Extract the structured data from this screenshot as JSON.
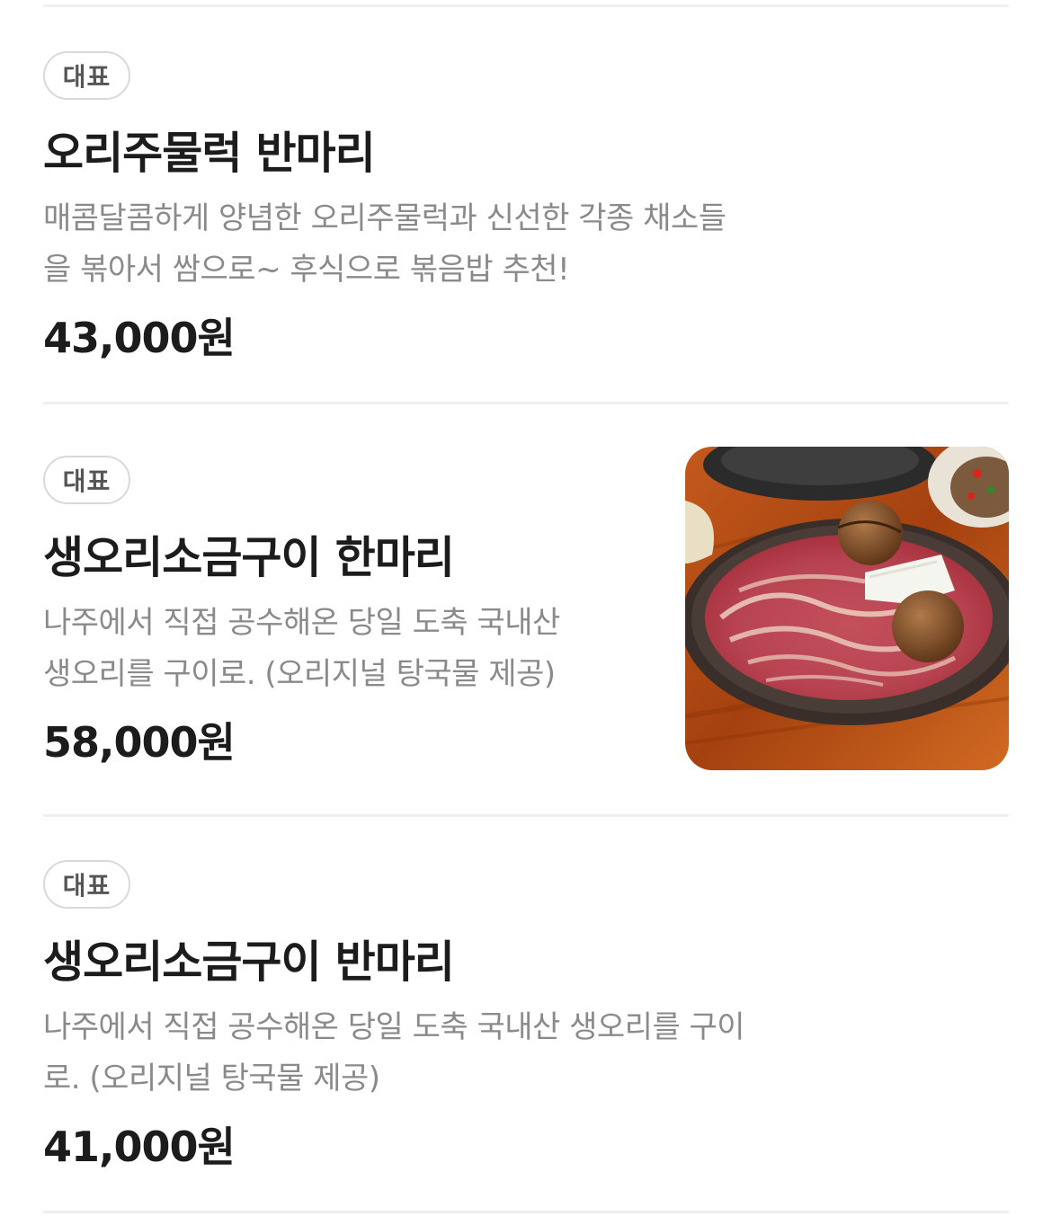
{
  "menu": {
    "items": [
      {
        "badge": "대표",
        "name": "오리주물럭 반마리",
        "desc_line1": "매콤달콤하게 양념한 오리주물럭과 신선한 각종 채소들",
        "desc_line2": "을 볶아서 쌈으로~ 후식으로 볶음밥 추천!",
        "price": "43,000원"
      },
      {
        "badge": "대표",
        "name": "생오리소금구이 한마리",
        "desc_line1": "나주에서 직접 공수해온 당일 도축 국내산",
        "desc_line2": "생오리를 구이로. (오리지널 탕국물 제공)",
        "price": "58,000원"
      },
      {
        "badge": "대표",
        "name": "생오리소금구이 반마리",
        "desc_line1": "나주에서 직접 공수해온 당일 도축 국내산 생오리를 구이",
        "desc_line2": "로. (오리지널 탕국물 제공)",
        "price": "41,000원"
      }
    ]
  },
  "colors": {
    "text_primary": "#1c1c1c",
    "text_secondary": "#8a8a8a",
    "divider": "#efefef",
    "badge_border": "#d9d9d9"
  },
  "icons": {
    "thumbnail": "grilled-duck-photo"
  }
}
